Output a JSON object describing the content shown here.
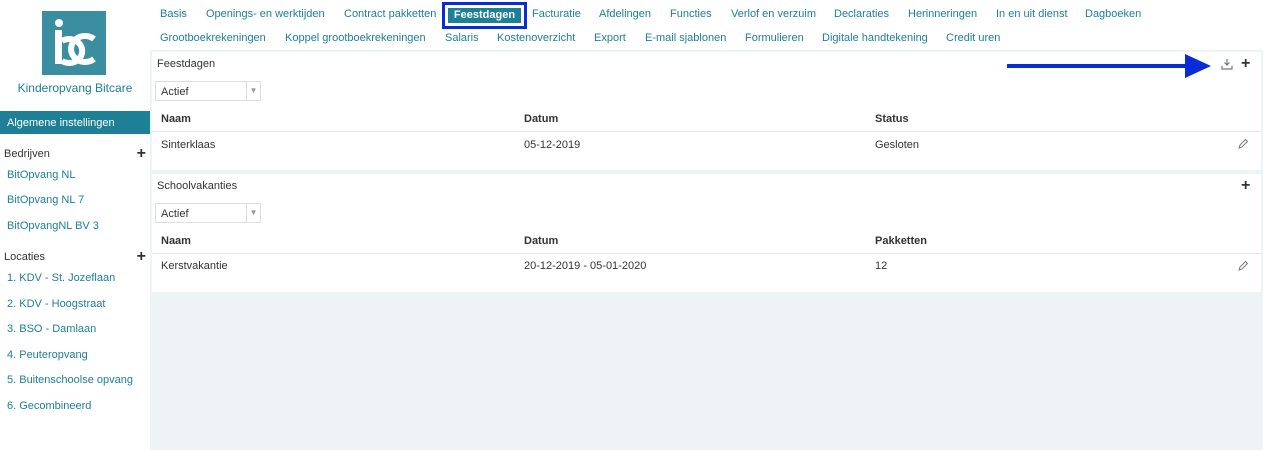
{
  "brand": {
    "name": "Kinderopvang Bitcare",
    "logo_color": "#3b8ea0"
  },
  "sidebar": {
    "active_section": "Algemene instellingen",
    "groups": [
      {
        "label": "Bedrijven",
        "items": [
          "BitOpvang NL",
          "BitOpvang NL 7",
          "BitOpvangNL BV 3"
        ]
      },
      {
        "label": "Locaties",
        "items": [
          "1. KDV - St. Jozeflaan",
          "2. KDV - Hoogstraat",
          "3. BSO - Damlaan",
          "4. Peuteropvang",
          "5. Buitenschoolse opvang",
          "6. Gecombineerd"
        ]
      }
    ]
  },
  "nav": {
    "row1": [
      "Basis",
      "Openings- en werktijden",
      "Contract pakketten",
      "Feestdagen",
      "Facturatie",
      "Afdelingen",
      "Functies",
      "Verlof en verzuim",
      "Declaraties",
      "Herinneringen",
      "In en uit dienst",
      "Dagboeken"
    ],
    "row2": [
      "Grootboekrekeningen",
      "Koppel grootboekrekeningen",
      "Salaris",
      "Kostenoverzicht",
      "Export",
      "E-mail sjablonen",
      "Formulieren",
      "Digitale handtekening",
      "Credit uren"
    ],
    "active": "Feestdagen"
  },
  "feestdagen": {
    "title": "Feestdagen",
    "filter": "Actief",
    "columns": [
      "Naam",
      "Datum",
      "Status"
    ],
    "rows": [
      [
        "Sinterklaas",
        "05-12-2019",
        "Gesloten"
      ]
    ]
  },
  "schoolvakanties": {
    "title": "Schoolvakanties",
    "filter": "Actief",
    "columns": [
      "Naam",
      "Datum",
      "Pakketten"
    ],
    "rows": [
      [
        "Kerstvakantie",
        "20-12-2019 - 05-01-2020",
        "12"
      ]
    ]
  },
  "colors": {
    "accent": "#1e8096",
    "highlight": "#0a2bd8",
    "background": "#eef3f6"
  }
}
